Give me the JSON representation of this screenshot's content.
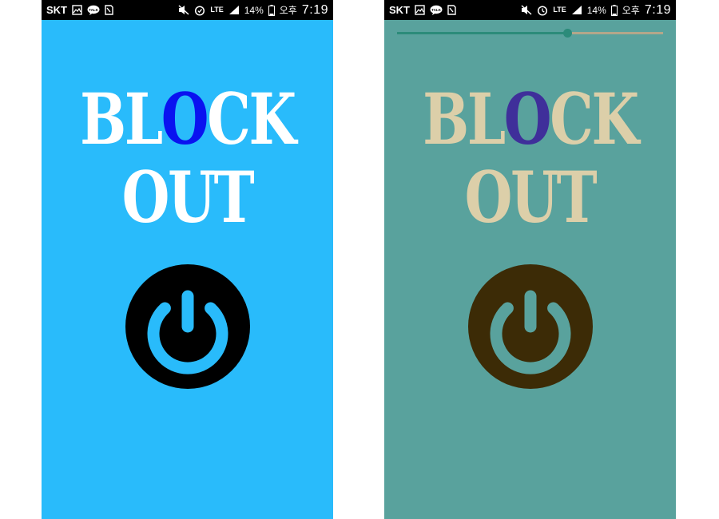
{
  "status_bar": {
    "carrier": "SKT",
    "network": "LTE",
    "battery": "14%",
    "ampm": "오후",
    "time": "7:19"
  },
  "app": {
    "logo_line1_pre": "BL",
    "logo_line1_o": "O",
    "logo_line1_post": "CK",
    "logo_line2": "OUT"
  },
  "screens": [
    {
      "name": "left-screen",
      "background": "#29bbfb",
      "power_button": {
        "state": "off",
        "ring_color": "#000000",
        "symbol_color": "#29bbfb"
      }
    },
    {
      "name": "right-screen",
      "background": "#59a29d",
      "power_button": {
        "state": "on",
        "ring_color": "#3c2b06",
        "symbol_color": "#59a29d"
      },
      "brightness_slider": {
        "value": 0.64
      }
    }
  ],
  "icons": [
    "gallery-icon",
    "talk-icon",
    "sd-card-icon",
    "mute-icon",
    "alarm-icon",
    "signal-icon",
    "battery-icon",
    "power-icon"
  ]
}
